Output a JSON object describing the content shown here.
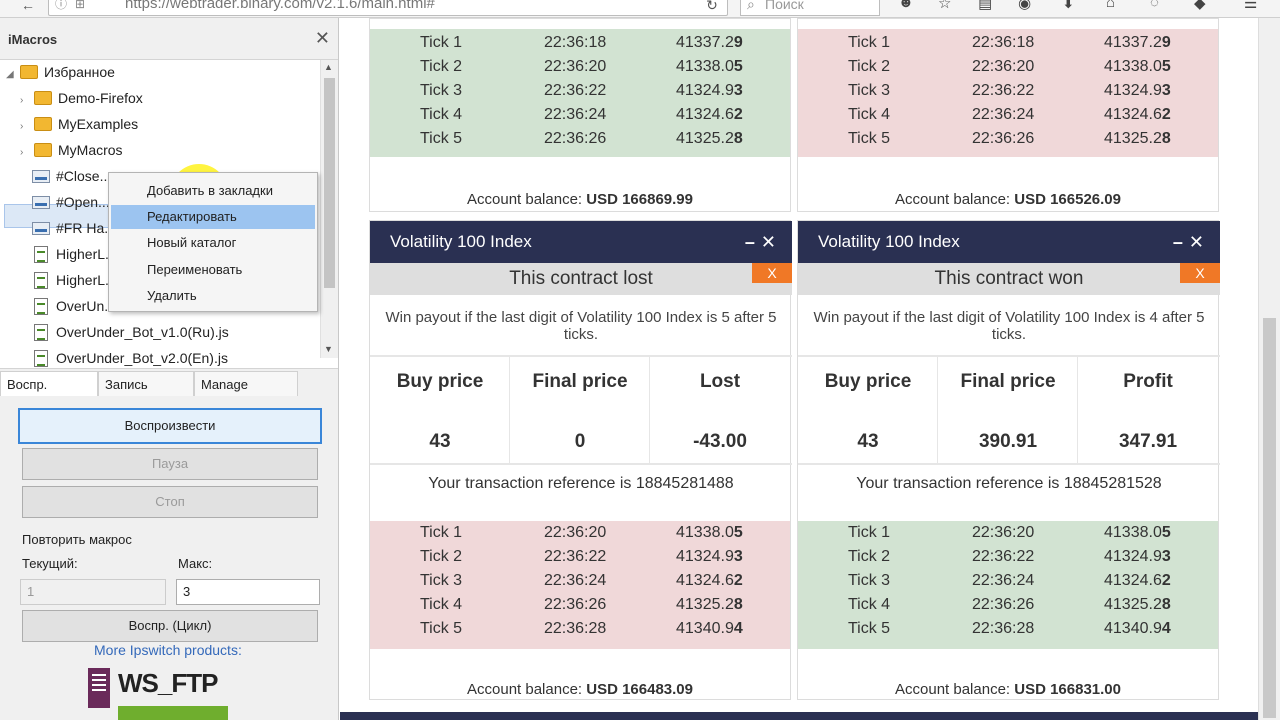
{
  "browser": {
    "url": "https://webtrader.binary.com/v2.1.6/main.html#",
    "search_placeholder": "Поиск"
  },
  "sidebar": {
    "title": "iMacros",
    "tree": [
      {
        "label": "Избранное",
        "kind": "folder",
        "expanded": true
      },
      {
        "label": "Demo-Firefox",
        "kind": "folder"
      },
      {
        "label": "MyExamples",
        "kind": "folder"
      },
      {
        "label": "MyMacros",
        "kind": "folder"
      },
      {
        "label": "#Close...",
        "kind": "macro"
      },
      {
        "label": "#Open...",
        "kind": "macro"
      },
      {
        "label": "#FR Ha...",
        "kind": "macro"
      },
      {
        "label": "HigherL...",
        "kind": "js"
      },
      {
        "label": "HigherL...",
        "kind": "js"
      },
      {
        "label": "OverUn...",
        "kind": "js"
      },
      {
        "label": "OverUnder_Bot_v1.0(Ru).js",
        "kind": "js"
      },
      {
        "label": "OverUnder_Bot_v2.0(En).js",
        "kind": "js"
      }
    ],
    "context_menu": [
      "Добавить в закладки",
      "Редактировать",
      "Новый каталог",
      "Переименовать",
      "Удалить"
    ],
    "tabs": [
      "Воспр.",
      "Запись",
      "Manage"
    ],
    "buttons": {
      "play": "Воспроизвести",
      "pause": "Пауза",
      "stop": "Стоп",
      "loop": "Воспр. (Цикл)"
    },
    "repeat_label": "Повторить макрос",
    "current_label": "Текущий:",
    "max_label": "Макс:",
    "current_value": "1",
    "max_value": "3",
    "more_link": "More Ipswitch products:",
    "logo_text": "WS_FTP"
  },
  "cards": {
    "top_left": {
      "ticks": [
        {
          "name": "Tick 1",
          "time": "22:36:18",
          "price": "41337.2",
          "last": "9"
        },
        {
          "name": "Tick 2",
          "time": "22:36:20",
          "price": "41338.0",
          "last": "5"
        },
        {
          "name": "Tick 3",
          "time": "22:36:22",
          "price": "41324.9",
          "last": "3"
        },
        {
          "name": "Tick 4",
          "time": "22:36:24",
          "price": "41324.6",
          "last": "2"
        },
        {
          "name": "Tick 5",
          "time": "22:36:26",
          "price": "41325.2",
          "last": "8"
        }
      ],
      "balance_label": "Account balance:",
      "balance_value": "USD 166869.99"
    },
    "top_right": {
      "ticks": [
        {
          "name": "Tick 1",
          "time": "22:36:18",
          "price": "41337.2",
          "last": "9"
        },
        {
          "name": "Tick 2",
          "time": "22:36:20",
          "price": "41338.0",
          "last": "5"
        },
        {
          "name": "Tick 3",
          "time": "22:36:22",
          "price": "41324.9",
          "last": "3"
        },
        {
          "name": "Tick 4",
          "time": "22:36:24",
          "price": "41324.6",
          "last": "2"
        },
        {
          "name": "Tick 5",
          "time": "22:36:26",
          "price": "41325.2",
          "last": "8"
        }
      ],
      "balance_label": "Account balance:",
      "balance_value": "USD 166526.09"
    },
    "bottom_left": {
      "title": "Volatility 100 Index",
      "status": "This contract lost",
      "close_x": "X",
      "description": "Win payout if the last digit of Volatility 100 Index is 5 after 5 ticks.",
      "buy_label": "Buy price",
      "final_label": "Final price",
      "result_label": "Lost",
      "buy_value": "43",
      "final_value": "0",
      "result_value": "-43.00",
      "reference": "Your transaction reference is 18845281488",
      "ticks": [
        {
          "name": "Tick 1",
          "time": "22:36:20",
          "price": "41338.0",
          "last": "5"
        },
        {
          "name": "Tick 2",
          "time": "22:36:22",
          "price": "41324.9",
          "last": "3"
        },
        {
          "name": "Tick 3",
          "time": "22:36:24",
          "price": "41324.6",
          "last": "2"
        },
        {
          "name": "Tick 4",
          "time": "22:36:26",
          "price": "41325.2",
          "last": "8"
        },
        {
          "name": "Tick 5",
          "time": "22:36:28",
          "price": "41340.9",
          "last": "4"
        }
      ],
      "balance_label": "Account balance:",
      "balance_value": "USD 166483.09"
    },
    "bottom_right": {
      "title": "Volatility 100 Index",
      "status": "This contract won",
      "close_x": "X",
      "description": "Win payout if the last digit of Volatility 100 Index is 4 after 5 ticks.",
      "buy_label": "Buy price",
      "final_label": "Final price",
      "result_label": "Profit",
      "buy_value": "43",
      "final_value": "390.91",
      "result_value": "347.91",
      "reference": "Your transaction reference is 18845281528",
      "ticks": [
        {
          "name": "Tick 1",
          "time": "22:36:20",
          "price": "41338.0",
          "last": "5"
        },
        {
          "name": "Tick 2",
          "time": "22:36:22",
          "price": "41324.9",
          "last": "3"
        },
        {
          "name": "Tick 3",
          "time": "22:36:24",
          "price": "41324.6",
          "last": "2"
        },
        {
          "name": "Tick 4",
          "time": "22:36:26",
          "price": "41325.2",
          "last": "8"
        },
        {
          "name": "Tick 5",
          "time": "22:36:28",
          "price": "41340.9",
          "last": "4"
        }
      ],
      "balance_label": "Account balance:",
      "balance_value": "USD 166831.00"
    }
  },
  "colors": {
    "header_navy": "#2a3052",
    "tick_green": "#d2e3d2",
    "tick_red": "#f0d8d9",
    "close_orange": "#f07826",
    "selection_blue": "#9cc4f0"
  },
  "icons": [
    "back-arrow-icon",
    "info-icon",
    "lock-icon",
    "reload-icon",
    "search-icon",
    "extension-icon",
    "star-icon",
    "reader-icon",
    "pocket-icon",
    "download-icon",
    "home-icon",
    "chat-icon",
    "menu-icon",
    "close-icon",
    "minimize-icon"
  ]
}
